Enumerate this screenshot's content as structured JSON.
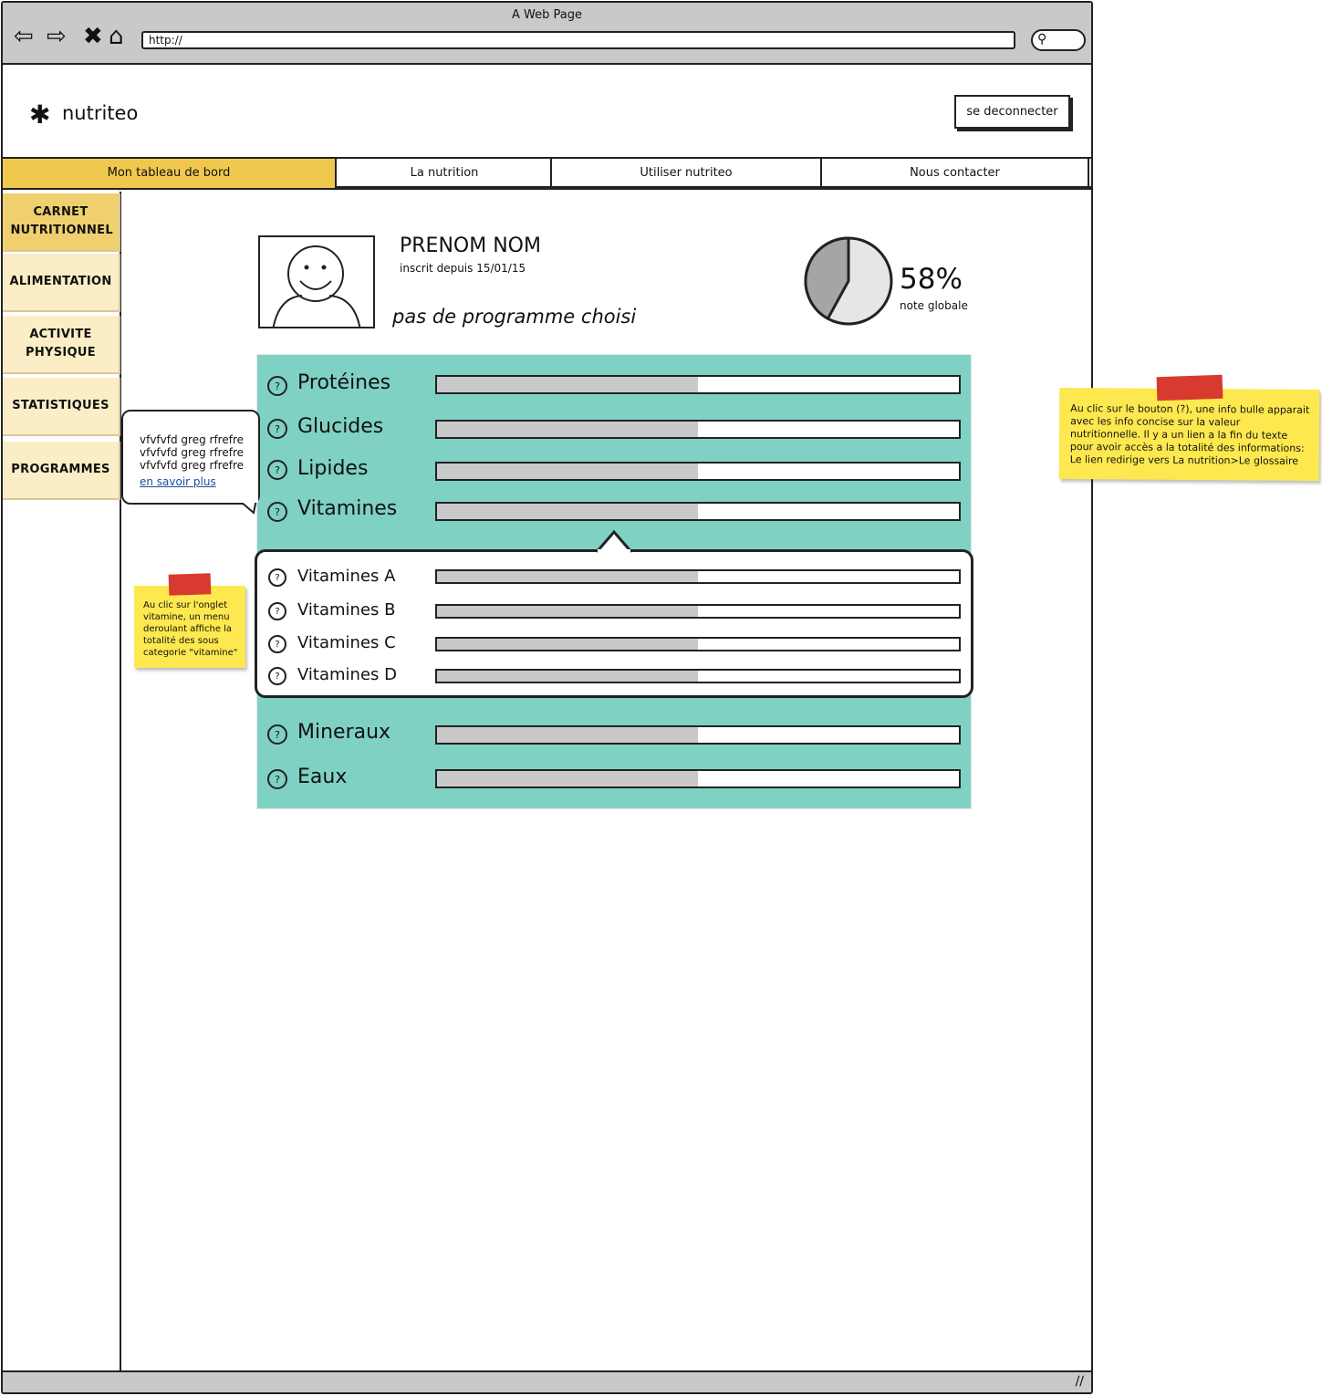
{
  "browser": {
    "title": "A Web Page",
    "url": "http://",
    "nav_icons": [
      "back-icon",
      "forward-icon",
      "close-icon",
      "home-icon"
    ],
    "search_icon": "search-icon"
  },
  "header": {
    "logo_icon": "asterisk-icon",
    "logo_text": "nutriteo",
    "logout_label": "se deconnecter"
  },
  "topnav": {
    "tabs": [
      {
        "label": "Mon tableau de bord",
        "active": true
      },
      {
        "label": "La nutrition",
        "active": false
      },
      {
        "label": "Utiliser nutriteo",
        "active": false
      },
      {
        "label": "Nous contacter",
        "active": false
      }
    ],
    "active_color": "#f0c84e"
  },
  "sidebar": {
    "items": [
      {
        "label": "CARNET NUTRITIONNEL",
        "active": true
      },
      {
        "label": "ALIMENTATION",
        "active": false
      },
      {
        "label": "ACTIVITE PHYSIQUE",
        "active": false
      },
      {
        "label": "STATISTIQUES",
        "active": false
      },
      {
        "label": "PROGRAMMES",
        "active": false
      }
    ]
  },
  "profile": {
    "name": "PRENOM NOM",
    "since": "inscrit depuis 15/01/15",
    "program": "pas de programme choisi",
    "score": "58%",
    "score_fraction": 0.58,
    "score_label": "note globale"
  },
  "nutrients": {
    "panel_color": "#7fd1c3",
    "help_icon": "?",
    "items": [
      {
        "label": "Protéines",
        "level": 0.5
      },
      {
        "label": "Glucides",
        "level": 0.5
      },
      {
        "label": "Lipides",
        "level": 0.5
      },
      {
        "label": "Vitamines",
        "level": 0.5
      },
      {
        "label": "Mineraux",
        "level": 0.5
      },
      {
        "label": "Eaux",
        "level": 0.5
      }
    ],
    "vitamins": [
      {
        "label": "Vitamines A",
        "level": 0.5
      },
      {
        "label": "Vitamines B",
        "level": 0.5
      },
      {
        "label": "Vitamines C",
        "level": 0.5
      },
      {
        "label": "Vitamines D",
        "level": 0.5
      }
    ]
  },
  "tooltip": {
    "lines": [
      "vfvfvfd greg rfrefre",
      "vfvfvfd greg rfrefre",
      "vfvfvfd greg rfrefre"
    ],
    "link": "en savoir plus"
  },
  "notes": {
    "left": "Au clic sur l'onglet vitamine, un menu deroulant affiche la totalité des sous categorie \"vitamine\"",
    "right": "Au clic sur le bouton (?), une info bulle apparait avec les info concise sur la valeur nutritionnelle. Il y a un lien a la fin du texte pour avoir accès a la totalité des informations: Le lien redirige vers La nutrition>Le glossaire"
  }
}
